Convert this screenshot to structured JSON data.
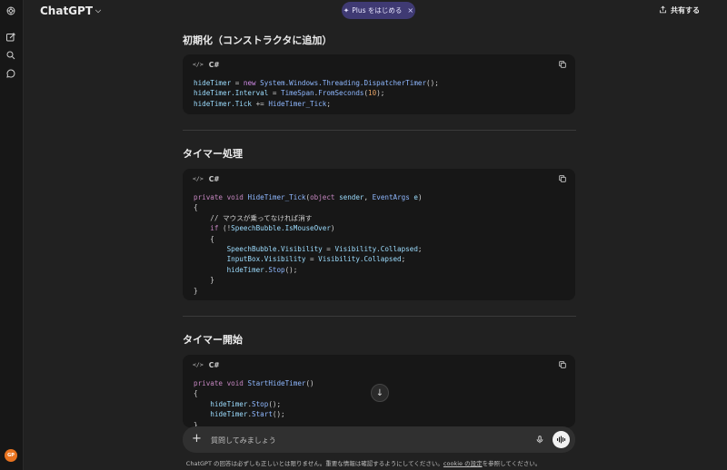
{
  "header": {
    "model_name": "ChatGPT",
    "plus_label": "Plus をはじめる",
    "share_label": "共有する"
  },
  "sidebar": {
    "icons": [
      "logo-icon",
      "new-chat-icon",
      "search-icon",
      "chat-icon"
    ],
    "avatar_initials": "GP"
  },
  "sections": [
    {
      "heading": "初期化（コンストラクタに追加）",
      "language": "C#",
      "code_icon": "</>"
    },
    {
      "heading": "タイマー処理",
      "language": "C#",
      "code_icon": "</>"
    },
    {
      "heading": "タイマー開始",
      "language": "C#",
      "code_icon": "</>"
    }
  ],
  "code1": {
    "l1a": "hideTimer",
    "l1b": " = ",
    "l1c": "new",
    "l1d": " ",
    "l1e": "System.Windows.Threading.DispatcherTimer",
    "l1f": "();",
    "l2a": "hideTimer.Interval",
    "l2b": " = ",
    "l2c": "TimeSpan",
    "l2d": ".",
    "l2e": "FromSeconds",
    "l2f": "(",
    "l2g": "10",
    "l2h": ");",
    "l3a": "hideTimer.Tick",
    "l3b": " += ",
    "l3c": "HideTimer_Tick",
    "l3d": ";"
  },
  "code2": {
    "sig_a": "private",
    "sig_b": " ",
    "sig_c": "void",
    "sig_d": " ",
    "sig_e": "HideTimer_Tick",
    "sig_f": "(",
    "sig_g": "object",
    "sig_h": " ",
    "sig_i": "sender",
    "sig_j": ", ",
    "sig_k": "EventArgs",
    "sig_l": " ",
    "sig_m": "e",
    "sig_n": ")",
    "open": "{",
    "comment": "    // マウスが乗ってなければ消す",
    "if_a": "    ",
    "if_b": "if",
    "if_c": " (!",
    "if_d": "SpeechBubble.IsMouseOver",
    "if_e": ")",
    "open2": "    {",
    "s1a": "        ",
    "s1b": "SpeechBubble.Visibility",
    "s1c": " = ",
    "s1d": "Visibility.Collapsed",
    "s1e": ";",
    "s2a": "        ",
    "s2b": "InputBox.Visibility",
    "s2c": " = ",
    "s2d": "Visibility.Collapsed",
    "s2e": ";",
    "s3a": "        ",
    "s3b": "hideTimer",
    "s3c": ".",
    "s3d": "Stop",
    "s3e": "();",
    "close2": "    }",
    "close": "}"
  },
  "code3": {
    "sig_a": "private",
    "sig_b": " ",
    "sig_c": "void",
    "sig_d": " ",
    "sig_e": "StartHideTimer",
    "sig_f": "()",
    "open": "{",
    "s1a": "    ",
    "s1b": "hideTimer",
    "s1c": ".",
    "s1d": "Stop",
    "s1e": "();",
    "s2a": "    ",
    "s2b": "hideTimer",
    "s2c": ".",
    "s2d": "Start",
    "s2e": "();",
    "close": "}"
  },
  "composer": {
    "placeholder": "質問してみましょう"
  },
  "footer": {
    "before": "ChatGPT の回答は必ずしも正しいとは限りません。重要な情報は確認するようにしてください。",
    "link": "cookie の設定",
    "after": "を参照してください。"
  }
}
